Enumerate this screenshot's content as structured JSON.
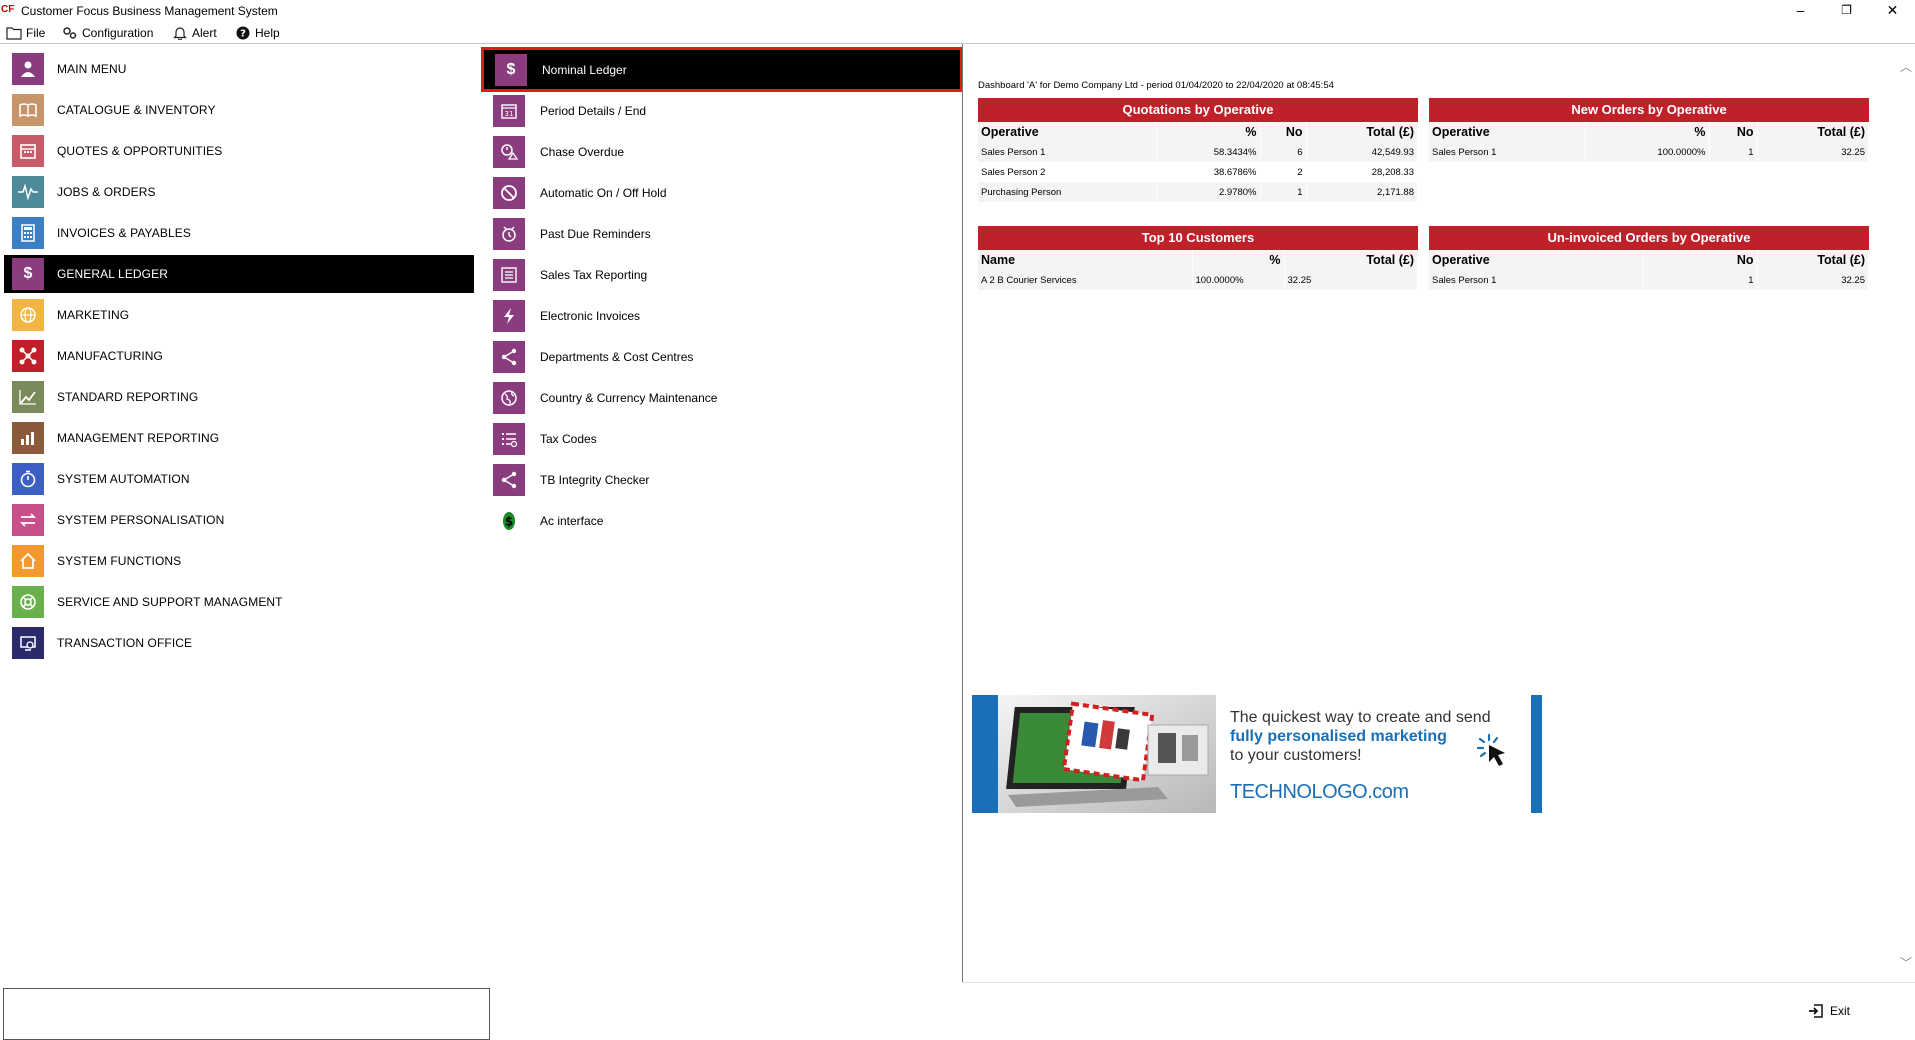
{
  "window": {
    "logo": "CF",
    "title": "Customer Focus Business Management System",
    "minimize": "–",
    "restore": "❐",
    "close": "✕"
  },
  "menubar": {
    "file": "File",
    "configuration": "Configuration",
    "alert": "Alert",
    "help": "Help"
  },
  "nav": {
    "items": [
      {
        "label": "MAIN MENU",
        "icon": "person-icon",
        "color": "#8a3d7e"
      },
      {
        "label": "CATALOGUE & INVENTORY",
        "icon": "book-icon",
        "color": "#c8946a"
      },
      {
        "label": "QUOTES & OPPORTUNITIES",
        "icon": "calendar-icon",
        "color": "#c85a6a"
      },
      {
        "label": "JOBS & ORDERS",
        "icon": "pulse-icon",
        "color": "#4d8a9a"
      },
      {
        "label": "INVOICES & PAYABLES",
        "icon": "calculator-icon",
        "color": "#3b7fc4"
      },
      {
        "label": "GENERAL LEDGER",
        "icon": "dollar-icon",
        "color": "#8a3d7e"
      },
      {
        "label": "MARKETING",
        "icon": "globe-icon",
        "color": "#f2b544"
      },
      {
        "label": "MANUFACTURING",
        "icon": "flow-icon",
        "color": "#c0202a"
      },
      {
        "label": "STANDARD REPORTING",
        "icon": "chart-icon",
        "color": "#7b8a5a"
      },
      {
        "label": "MANAGEMENT REPORTING",
        "icon": "bar-chart-icon",
        "color": "#8a5a3a"
      },
      {
        "label": "SYSTEM AUTOMATION",
        "icon": "timer-icon",
        "color": "#3b5fc4"
      },
      {
        "label": "SYSTEM PERSONALISATION",
        "icon": "swap-icon",
        "color": "#c8508a"
      },
      {
        "label": "SYSTEM FUNCTIONS",
        "icon": "home-icon",
        "color": "#f29a30"
      },
      {
        "label": "SERVICE AND SUPPORT MANAGMENT",
        "icon": "lifebuoy-icon",
        "color": "#6ab04c"
      },
      {
        "label": "TRANSACTION OFFICE",
        "icon": "monitor-icon",
        "color": "#2a2a6a"
      }
    ]
  },
  "submenu": {
    "items": [
      {
        "label": "Nominal Ledger",
        "icon": "dollar-icon"
      },
      {
        "label": "Period Details / End",
        "icon": "calendar-31-icon"
      },
      {
        "label": "Chase Overdue",
        "icon": "chase-icon"
      },
      {
        "label": "Automatic On / Off Hold",
        "icon": "block-icon"
      },
      {
        "label": "Past Due Reminders",
        "icon": "reminder-icon"
      },
      {
        "label": "Sales Tax Reporting",
        "icon": "list-icon"
      },
      {
        "label": "Electronic Invoices",
        "icon": "bolt-icon"
      },
      {
        "label": "Departments & Cost Centres",
        "icon": "share-icon"
      },
      {
        "label": "Country & Currency Maintenance",
        "icon": "globe-icon"
      },
      {
        "label": "Tax Codes",
        "icon": "tax-list-icon"
      },
      {
        "label": "TB Integrity Checker",
        "icon": "share-icon"
      },
      {
        "label": "Ac interface",
        "icon": "money-icon"
      }
    ],
    "accent": "#8a3d7e"
  },
  "dashboard": {
    "caption": "Dashboard 'A' for Demo Company Ltd - period 01/04/2020 to 22/04/2020 at 08:45:54",
    "quotations": {
      "title": "Quotations by Operative",
      "headers": [
        "Operative",
        "%",
        "No",
        "Total (£)"
      ],
      "rows": [
        [
          "Sales Person 1",
          "58.3434%",
          "6",
          "42,549.93"
        ],
        [
          "Sales Person 2",
          "38.6786%",
          "2",
          "28,208.33"
        ],
        [
          "Purchasing Person",
          "2.9780%",
          "1",
          "2,171.88"
        ]
      ]
    },
    "new_orders": {
      "title": "New Orders by Operative",
      "headers": [
        "Operative",
        "%",
        "No",
        "Total (£)"
      ],
      "rows": [
        [
          "Sales Person 1",
          "100.0000%",
          "1",
          "32.25"
        ]
      ]
    },
    "top_customers": {
      "title": "Top 10 Customers",
      "headers": [
        "Name",
        "%",
        "Total (£)"
      ],
      "rows": [
        [
          "A 2 B Courier Services",
          "100.0000%",
          "32.25"
        ]
      ]
    },
    "uninvoiced": {
      "title": "Un-invoiced Orders by Operative",
      "headers": [
        "Operative",
        "No",
        "Total (£)"
      ],
      "rows": [
        [
          "Sales Person 1",
          "1",
          "32.25"
        ]
      ]
    },
    "header_color": "#c0202a"
  },
  "ad": {
    "line1": "The quickest way to create and send",
    "line2": "fully personalised marketing",
    "line3": "to your customers!",
    "brand": "TECHNOLOGO",
    "brand_suffix": ".com",
    "color": "#1a6fb6"
  },
  "footer": {
    "exit_label": "Exit"
  }
}
